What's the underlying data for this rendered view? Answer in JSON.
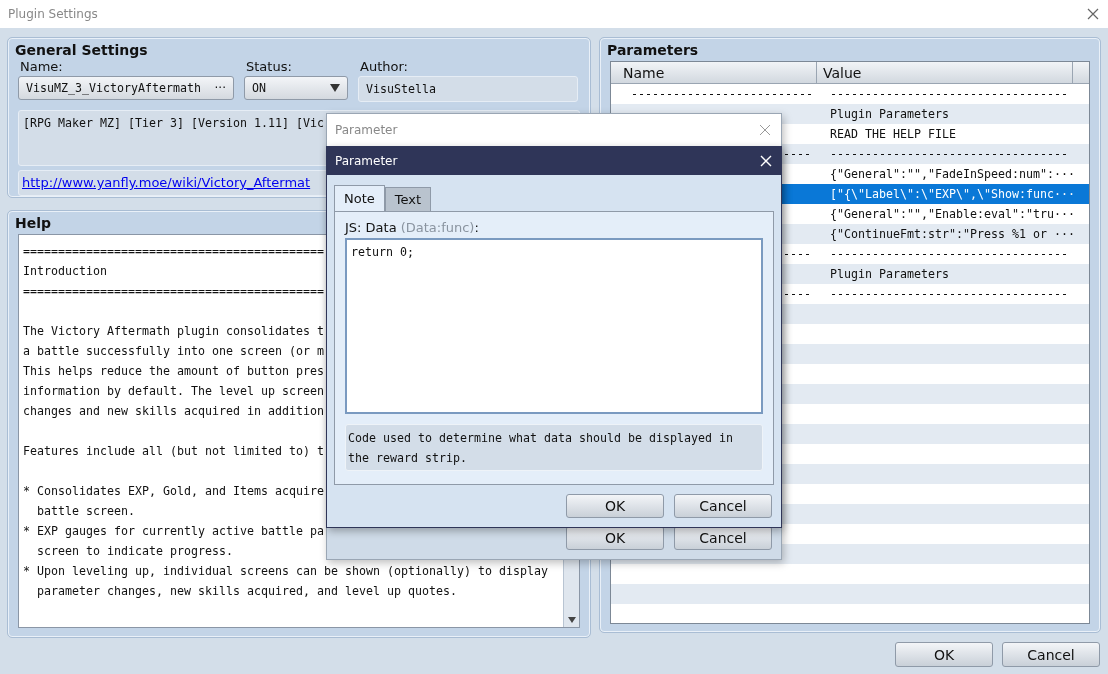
{
  "window": {
    "title": "Plugin Settings"
  },
  "general_settings": {
    "title": "General Settings",
    "name": {
      "label": "Name:",
      "value": "VisuMZ_3_VictoryAftermath",
      "button": "···"
    },
    "status": {
      "label": "Status:",
      "value": "ON"
    },
    "author": {
      "label": "Author:",
      "value": "VisuStella"
    },
    "description": "[RPG Maker MZ] [Tier 3] [Version 1.11] [Vic",
    "url": "http://www.yanfly.moe/wiki/Victory_Aftermat"
  },
  "help": {
    "title": "Help",
    "paragraphs": [
      [
        "===========================================",
        "Introduction",
        "==========================================="
      ],
      [
        "The Victory Aftermath plugin consolidates t",
        "a battle successfully into one screen (or m",
        "This helps reduce the amount of button pres",
        "information by default. The level up screen",
        "changes and new skills acquired in addition"
      ],
      [
        "Features include all (but not limited to) t"
      ],
      [
        "* Consolidates EXP, Gold, and Items acquire",
        "  battle screen.",
        "* EXP gauges for currently active battle pa",
        "  screen to indicate progress.",
        "* Upon leveling up, individual screens can be shown (optionally) to display",
        "  parameter changes, new skills acquired, and level up quotes."
      ]
    ]
  },
  "parameters": {
    "title": "Parameters",
    "columns": [
      "Name",
      "Value"
    ],
    "rows": [
      {
        "name": "--------------------------",
        "value": "----------------------------------",
        "selected": false
      },
      {
        "value": "Plugin Parameters",
        "selected": false
      },
      {
        "value": "READ THE HELP FILE",
        "selected": false
      },
      {
        "name": "----",
        "value": "----------------------------------",
        "selected": false
      },
      {
        "value": "{\"General\":\"\",\"FadeInSpeed:num\":···",
        "selected": false
      },
      {
        "value": "[\"{\\\"Label\\\":\\\"EXP\\\",\\\"Show:func···",
        "selected": true
      },
      {
        "value": "{\"General\":\"\",\"Enable:eval\":\"tru···",
        "selected": false
      },
      {
        "value": "{\"ContinueFmt:str\":\"Press %1 or ···",
        "selected": false
      },
      {
        "name": "----",
        "value": "----------------------------------",
        "selected": false
      },
      {
        "value": "Plugin Parameters",
        "selected": false
      },
      {
        "name": "----",
        "value": "----------------------------------",
        "selected": false
      }
    ]
  },
  "buttons": [
    "OK",
    "Cancel"
  ],
  "back_dialog": {
    "title": "Parameter",
    "buttons": [
      "OK",
      "Cancel"
    ]
  },
  "dialog": {
    "title": "Parameter",
    "tabs": [
      {
        "label": "Note",
        "selected": true
      },
      {
        "label": "Text",
        "selected": false
      }
    ],
    "field_label": "JS: Data",
    "field_type": "(Data:func)",
    "field_label_end": ":",
    "code": "return 0;",
    "description": "Code used to determine what data should be displayed in the reward strip.",
    "buttons": [
      "OK",
      "Cancel"
    ]
  }
}
